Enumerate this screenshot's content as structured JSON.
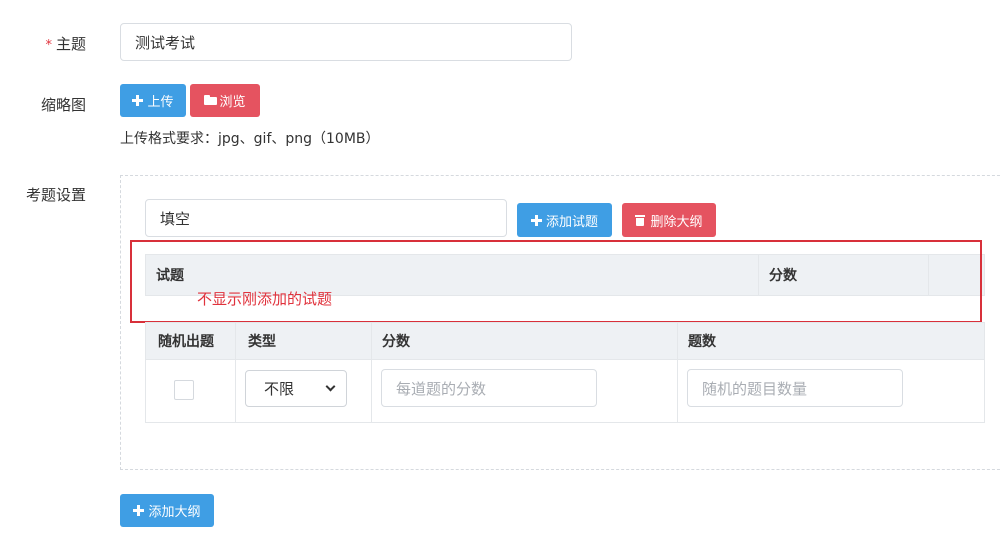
{
  "form": {
    "subject": {
      "required_mark": "*",
      "label": "主题",
      "value": "测试考试"
    },
    "thumbnail": {
      "label": "缩略图",
      "upload_label": "上传",
      "browse_label": "浏览",
      "hint": "上传格式要求：jpg、gif、png（10MB）"
    },
    "question_settings": {
      "label": "考题设置",
      "outline_name": "填空",
      "add_question_label": "添加试题",
      "delete_outline_label": "删除大纲",
      "outline_table_headers": [
        "试题",
        "分数"
      ],
      "annotation": "不显示刚添加的试题",
      "random_table": {
        "headers": [
          "随机出题",
          "类型",
          "分数",
          "题数"
        ],
        "type_value": "不限",
        "score_placeholder": "每道题的分数",
        "count_placeholder": "随机的题目数量"
      }
    },
    "add_outline_label": "添加大纲"
  },
  "colors": {
    "primary": "#3f9ee4",
    "danger": "#e55360",
    "annotation": "#d8303a"
  },
  "icons": [
    "plus-icon",
    "folder-open-icon",
    "trash-icon",
    "chevron-down-icon"
  ]
}
